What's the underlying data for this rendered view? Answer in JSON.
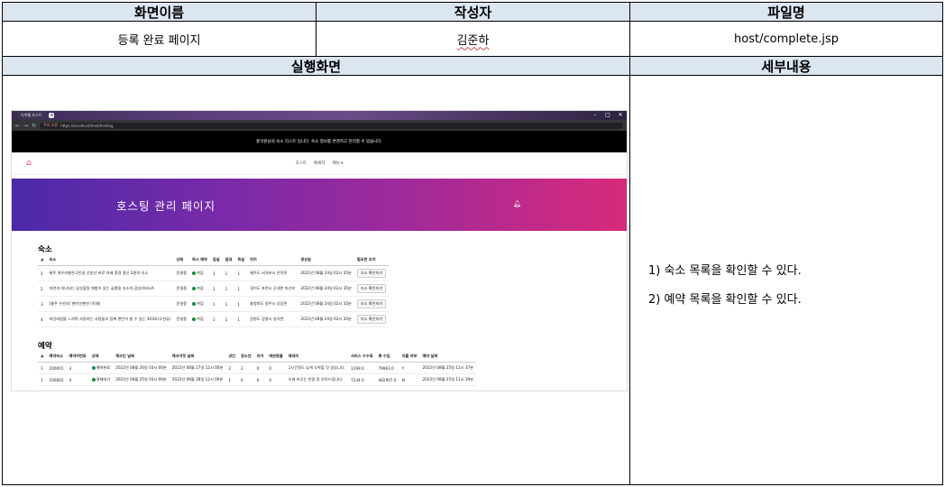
{
  "header": {
    "screen_name_label": "화면이름",
    "author_label": "작성자",
    "file_name_label": "파일명",
    "screen_name": "등록 완료 페이지",
    "author": "김준하",
    "file_name": "host/complete.jsp",
    "execution_label": "실행화면",
    "details_label": "세부내용"
  },
  "details": [
    "1) 숙소 목록을 확인할 수 있다.",
    "2) 예약 목록을 확인할 수 있다."
  ],
  "screenshot": {
    "tab_title": "숙박웹 호스트",
    "url_warning": "주의 요함",
    "url": "https://localhost/host/hosting",
    "notice": "홍먹원님의 숙소 리스트 입니다. 숙소 정보를 변경하고 관리할 수 있습니다.",
    "nav": [
      "호스트",
      "메세지",
      "메뉴 ▾"
    ],
    "banner_title": "호스팅 관리 페이지",
    "listings_title": "숙소",
    "listings_headers": [
      "#",
      "숙소",
      "상태",
      "즉시 예약",
      "침실",
      "침대",
      "욕실",
      "위치",
      "생성일",
      "필요한 조치"
    ],
    "listings": [
      [
        "1",
        "제주 게우리펜션 2인실 산방산 바로 아래 풍경 좋은 2층의 숙소",
        "운영중",
        "켜짐",
        "1",
        "1",
        "1",
        "제주도 서귀포시 안덕면",
        "2022년 08월 24일 02시 35분",
        "숙소 확인하기"
      ],
      [
        "2",
        "자연과 하나되는 감성힐링 체험이 있는 글램핑 숙소의 감성카바나A",
        "운영중",
        "켜짐",
        "1",
        "1",
        "1",
        "경기도 포천시 군내면 마산리",
        "2022년 08월 24일 02시 35분",
        "숙소 확인하기"
      ],
      [
        "3",
        "[충주 수안보] 펜이인펜션 (독채)",
        "운영중",
        "켜짐",
        "1",
        "1",
        "1",
        "충청북도 청주시 상당면",
        "2022년 08월 24일 02시 35분",
        "숙소 확인하기"
      ],
      [
        "4",
        "바닷바람을 느끼며 사랑하는 사람들과 함께 편안히 쉴 수 있는 303호(오션뷰)",
        "운영중",
        "켜짐",
        "1",
        "1",
        "1",
        "강원도 강릉시 영곡면",
        "2022년 08월 24일 02시 35분",
        "숙소 확인하기"
      ]
    ],
    "reservations_title": "예약",
    "reservations_headers": [
      "#",
      "예약숙소",
      "예약자번호",
      "상태",
      "체크인 날짜",
      "체크아웃 날짜",
      "성인",
      "청소년",
      "유아",
      "애완동물",
      "메세지",
      "서비스 수수료",
      "총 수입",
      "지불 여부",
      "예약 날짜"
    ],
    "reservations": [
      [
        "1",
        "100001",
        "3",
        "예약완료",
        "2022년 08월 26일 03시 00분",
        "2022년 08월 27일 12시 00분",
        "2",
        "2",
        "0",
        "0",
        "1시간정도 늦게 도착할 것 같습니다.",
        "1199.0",
        "79963.0",
        "Y",
        "2022년 08월 25일 11시 37분"
      ],
      [
        "1",
        "100002",
        "4",
        "결제대기",
        "2022년 08월 25일 03시 00분",
        "2022년 08월 28일 12시 00분",
        "1",
        "0",
        "0",
        "0",
        "오래 머무는 만큼 잘 부탁드립니다.",
        "7234.0",
        "482907.0",
        "N",
        "2022년 08월 25일 11시 39분"
      ]
    ]
  }
}
